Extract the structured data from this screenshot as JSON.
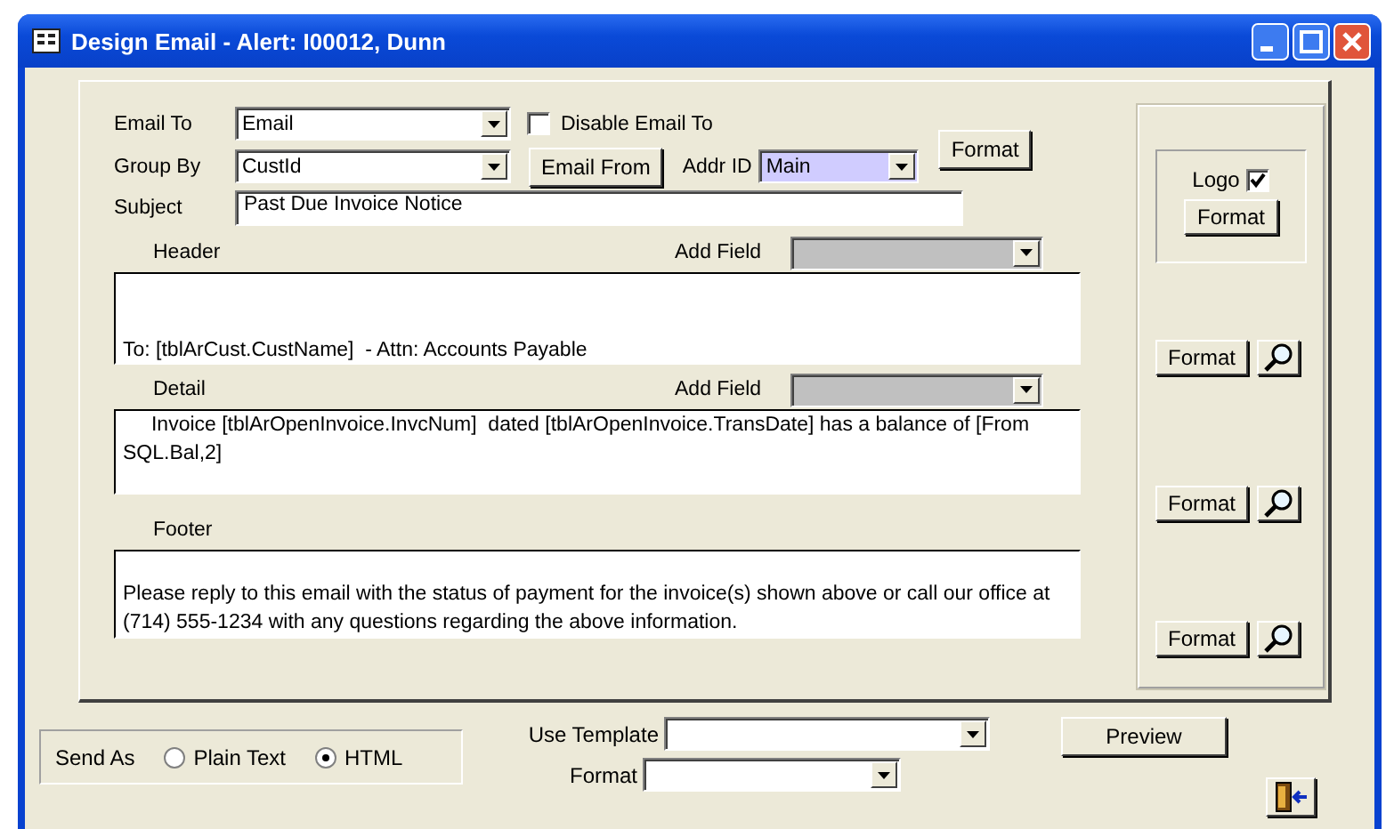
{
  "window": {
    "title": "Design Email - Alert: I00012, Dunn"
  },
  "email_to": {
    "label": "Email To",
    "value": "Email"
  },
  "disable_email_to": {
    "label": "Disable Email To",
    "checked": false
  },
  "group_by": {
    "label": "Group  By",
    "value": "CustId"
  },
  "email_from_button": "Email From",
  "addr_id": {
    "label": "Addr ID",
    "value": "Main"
  },
  "format_button": "Format",
  "subject": {
    "label": "Subject",
    "value": "Past Due Invoice Notice"
  },
  "logo": {
    "label": "Logo",
    "checked": true,
    "format_button": "Format"
  },
  "sections": [
    {
      "label": "Header",
      "add_field_label": "Add Field",
      "text": "\n\nTo: [tblArCust.CustName]  - Attn: Accounts Payable",
      "format_button": "Format"
    },
    {
      "label": "Detail",
      "add_field_label": "Add Field",
      "text": "     Invoice [tblArOpenInvoice.InvcNum]  dated [tblArOpenInvoice.TransDate] has a balance of [From SQL.Bal,2]",
      "format_button": "Format"
    },
    {
      "label": "Footer",
      "text": "\nPlease reply to this email with the status of payment for the invoice(s) shown above or call our office at (714) 555-1234 with any questions regarding the above information.",
      "format_button": "Format"
    }
  ],
  "send_as": {
    "label": "Send As",
    "options": [
      {
        "label": "Plain Text",
        "selected": false
      },
      {
        "label": "HTML",
        "selected": true
      }
    ]
  },
  "use_template": {
    "label": "Use Template"
  },
  "template_format": {
    "label": "Format"
  },
  "preview_button": "Preview"
}
